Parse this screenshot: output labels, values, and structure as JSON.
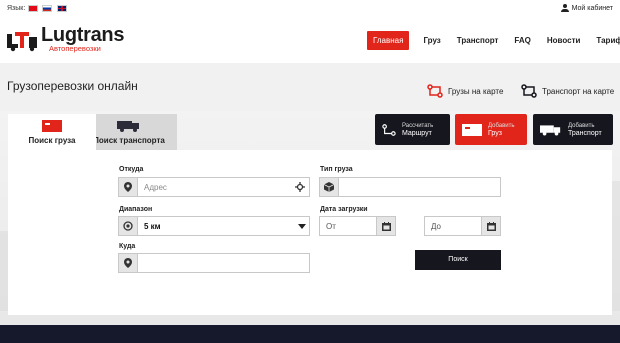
{
  "topbar": {
    "language_label": "Язык:",
    "cabinet_label": "Мой кабинет"
  },
  "logo": {
    "title": "Lugtrans",
    "subtitle": "Автоперевозки"
  },
  "nav": {
    "items": [
      "Главная",
      "Груз",
      "Транспорт",
      "FAQ",
      "Новости",
      "Тарифы"
    ]
  },
  "subheader": {
    "title": "Грузоперевозки онлайн",
    "cargo_map": "Грузы на карте",
    "transport_map": "Транспорт на карте"
  },
  "tabs": {
    "cargo": "Поиск груза",
    "transport": "Поиск транспорта"
  },
  "actions": {
    "route_small": "Рассчитать",
    "route_main": "Маршрут",
    "add_cargo_small": "Добавить",
    "add_cargo_main": "Груз",
    "add_transport_small": "Добавить",
    "add_transport_main": "Транспорт"
  },
  "form": {
    "from_label": "Откуда",
    "from_placeholder": "Адрес",
    "range_label": "Диапазон",
    "range_value": "5 км",
    "to_label": "Куда",
    "cargo_type_label": "Тип груза",
    "load_date_label": "Дата загрузки",
    "date_from": "От",
    "date_to": "До",
    "search_button": "Поиск"
  },
  "colors": {
    "accent": "#e1251b",
    "dark": "#16161f",
    "footer": "#16192b"
  }
}
